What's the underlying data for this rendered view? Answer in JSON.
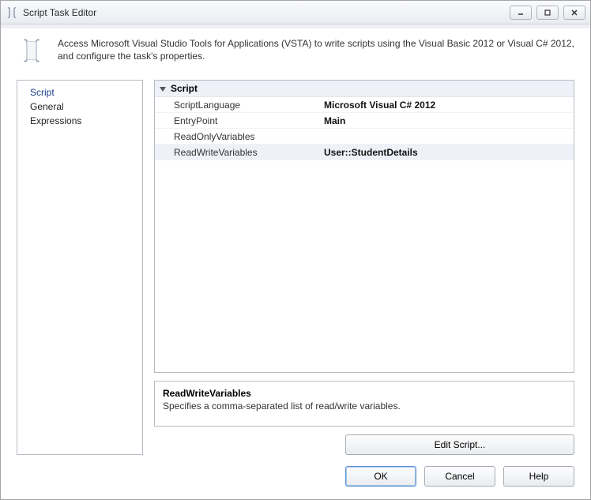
{
  "window": {
    "title": "Script Task Editor"
  },
  "header": {
    "description": "Access Microsoft Visual Studio Tools for Applications (VSTA) to write scripts using the Visual Basic 2012 or Visual C# 2012, and configure the task's properties."
  },
  "nav": {
    "items": [
      {
        "label": "Script",
        "selected": true
      },
      {
        "label": "General",
        "selected": false
      },
      {
        "label": "Expressions",
        "selected": false
      }
    ]
  },
  "grid": {
    "category": "Script",
    "rows": [
      {
        "label": "ScriptLanguage",
        "value": "Microsoft Visual C# 2012",
        "selected": false
      },
      {
        "label": "EntryPoint",
        "value": "Main",
        "selected": false
      },
      {
        "label": "ReadOnlyVariables",
        "value": "",
        "selected": false
      },
      {
        "label": "ReadWriteVariables",
        "value": "User::StudentDetails",
        "selected": true
      }
    ]
  },
  "help_panel": {
    "title": "ReadWriteVariables",
    "description": "Specifies a comma-separated list of read/write variables."
  },
  "buttons": {
    "edit_script": "Edit Script...",
    "ok": "OK",
    "cancel": "Cancel",
    "help": "Help"
  }
}
